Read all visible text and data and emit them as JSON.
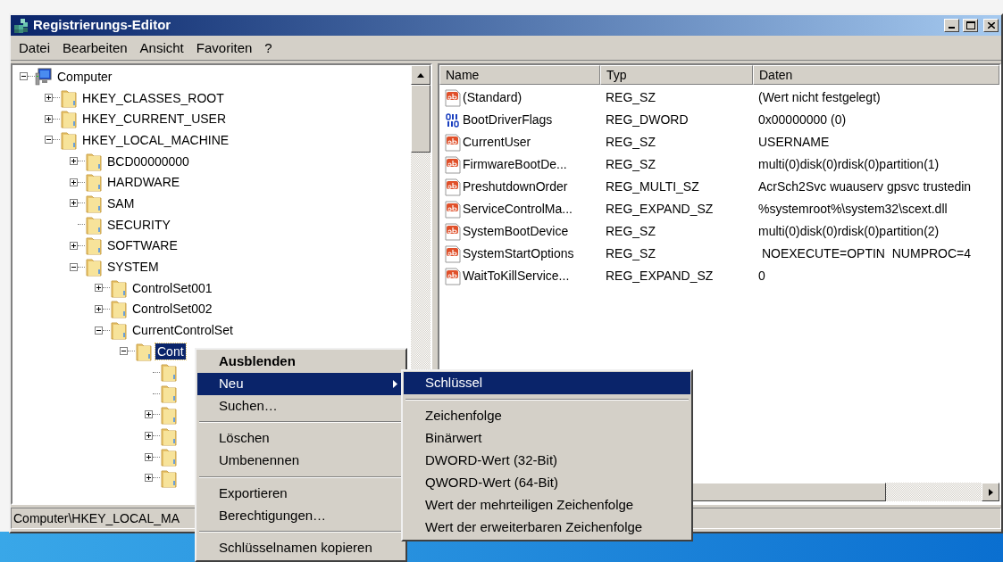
{
  "window": {
    "title": "Registrierungs-Editor"
  },
  "menu_bar": [
    "Datei",
    "Bearbeiten",
    "Ansicht",
    "Favoriten",
    "?"
  ],
  "tree": [
    {
      "label": "Computer",
      "kind": "computer",
      "expanded": true,
      "selected": false,
      "children": [
        {
          "label": "HKEY_CLASSES_ROOT",
          "expanded": false,
          "selected": false
        },
        {
          "label": "HKEY_CURRENT_USER",
          "expanded": false,
          "selected": false
        },
        {
          "label": "HKEY_LOCAL_MACHINE",
          "expanded": true,
          "selected": false,
          "children": [
            {
              "label": "BCD00000000",
              "expanded": false,
              "selected": false
            },
            {
              "label": "HARDWARE",
              "expanded": false,
              "selected": false
            },
            {
              "label": "SAM",
              "expanded": false,
              "selected": false
            },
            {
              "label": "SECURITY",
              "selected": false
            },
            {
              "label": "SOFTWARE",
              "expanded": false,
              "selected": false
            },
            {
              "label": "SYSTEM",
              "expanded": true,
              "selected": false,
              "children": [
                {
                  "label": "ControlSet001",
                  "expanded": false,
                  "selected": false
                },
                {
                  "label": "ControlSet002",
                  "expanded": false,
                  "selected": false
                },
                {
                  "label": "CurrentControlSet",
                  "expanded": true,
                  "selected": false,
                  "children": [
                    {
                      "label": "Cont",
                      "expanded": true,
                      "selected": true,
                      "children": [
                        {
                          "selected": false
                        },
                        {
                          "selected": false
                        },
                        {
                          "expanded": false,
                          "selected": false
                        },
                        {
                          "expanded": false,
                          "selected": false
                        },
                        {
                          "expanded": false,
                          "selected": false
                        },
                        {
                          "expanded": false,
                          "selected": false
                        }
                      ]
                    }
                  ]
                }
              ]
            }
          ]
        }
      ]
    }
  ],
  "table": {
    "columns": [
      "Name",
      "Typ",
      "Daten"
    ],
    "rows": [
      {
        "kind": "string",
        "name": "(Standard)",
        "type": "REG_SZ",
        "data": "(Wert nicht festgelegt)"
      },
      {
        "kind": "binary",
        "name": "BootDriverFlags",
        "type": "REG_DWORD",
        "data": "0x00000000 (0)"
      },
      {
        "kind": "string",
        "name": "CurrentUser",
        "type": "REG_SZ",
        "data": "USERNAME"
      },
      {
        "kind": "string",
        "name": "FirmwareBootDe...",
        "type": "REG_SZ",
        "data": "multi(0)disk(0)rdisk(0)partition(1)"
      },
      {
        "kind": "string",
        "name": "PreshutdownOrder",
        "type": "REG_MULTI_SZ",
        "data": "AcrSch2Svc wuauserv gpsvc trustedin"
      },
      {
        "kind": "string",
        "name": "ServiceControlMa...",
        "type": "REG_EXPAND_SZ",
        "data": "%systemroot%\\system32\\scext.dll"
      },
      {
        "kind": "string",
        "name": "SystemBootDevice",
        "type": "REG_SZ",
        "data": "multi(0)disk(0)rdisk(0)partition(2)"
      },
      {
        "kind": "string",
        "name": "SystemStartOptions",
        "type": "REG_SZ",
        "data": " NOEXECUTE=OPTIN  NUMPROC=4"
      },
      {
        "kind": "string",
        "name": "WaitToKillService...",
        "type": "REG_EXPAND_SZ",
        "data": "0"
      }
    ]
  },
  "status_bar": "Computer\\HKEY_LOCAL_MA",
  "context_menu": [
    {
      "kind": "item",
      "label": "Ausblenden",
      "default": true,
      "selected": false
    },
    {
      "kind": "item",
      "label": "Neu",
      "submenu": true,
      "selected": true
    },
    {
      "kind": "item",
      "label": "Suchen…",
      "selected": false
    },
    {
      "kind": "separator"
    },
    {
      "kind": "item",
      "label": "Löschen",
      "selected": false
    },
    {
      "kind": "item",
      "label": "Umbenennen",
      "selected": false
    },
    {
      "kind": "separator"
    },
    {
      "kind": "item",
      "label": "Exportieren",
      "selected": false
    },
    {
      "kind": "item",
      "label": "Berechtigungen…",
      "selected": false
    },
    {
      "kind": "separator"
    },
    {
      "kind": "item",
      "label": "Schlüsselnamen kopieren",
      "selected": false
    }
  ],
  "submenu": [
    {
      "kind": "item",
      "label": "Schlüssel",
      "selected": true
    },
    {
      "kind": "separator"
    },
    {
      "kind": "item",
      "label": "Zeichenfolge",
      "selected": false
    },
    {
      "kind": "item",
      "label": "Binärwert",
      "selected": false
    },
    {
      "kind": "item",
      "label": "DWORD-Wert (32-Bit)",
      "selected": false
    },
    {
      "kind": "item",
      "label": "QWORD-Wert (64-Bit)",
      "selected": false
    },
    {
      "kind": "item",
      "label": "Wert der mehrteiligen Zeichenfolge",
      "selected": false
    },
    {
      "kind": "item",
      "label": "Wert der erweiterbaren Zeichenfolge",
      "selected": false
    }
  ]
}
